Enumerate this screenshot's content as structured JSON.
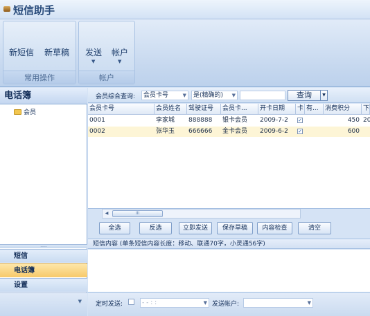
{
  "app": {
    "title": "短信助手",
    "icon": "app-logo-icon"
  },
  "ribbon": {
    "groups": [
      {
        "label": "常用操作",
        "buttons": [
          "新短信",
          "新草稿"
        ]
      },
      {
        "label": "帐户",
        "buttons": [
          "发送",
          "帐户"
        ]
      }
    ]
  },
  "sidebar": {
    "header": "电话簿",
    "tree_item": "会员",
    "nav_buttons": [
      "短信",
      "电话簿",
      "设置"
    ],
    "active": "电话簿"
  },
  "query": {
    "label": "会员综合查询:",
    "field": "会员卡号",
    "condition": "是(精确的)",
    "value": "",
    "button": "查询"
  },
  "grid": {
    "columns": [
      "会员卡号",
      "会员姓名",
      "驾驶证号",
      "会员卡...",
      "开卡日期",
      "卡...",
      "有...",
      "消费积分",
      "下"
    ],
    "rows": [
      {
        "card_no": "0001",
        "name": "李家城",
        "license": "888888",
        "card_type": "银卡会员",
        "open_date": "2009-7-2",
        "checked": true,
        "points": "450",
        "next": "20"
      },
      {
        "card_no": "0002",
        "name": "张华玉",
        "license": "666666",
        "card_type": "金卡会员",
        "open_date": "2009-6-2",
        "checked": true,
        "points": "600",
        "next": ""
      }
    ],
    "scroll_thumb": "III"
  },
  "actions": [
    "全选",
    "反选",
    "立即发送",
    "保存草稿",
    "内容检查",
    "清空"
  ],
  "sms": {
    "label": "短信内容 (单条短信内容长度：移动、联通70字，小灵通56字)",
    "content": ""
  },
  "footer": {
    "timed_label": "定时发送:",
    "datetime_placeholder": "- -   : :",
    "account_label": "发送帐户:",
    "account_value": ""
  },
  "colors": {
    "active_nav": "#f7c969",
    "selected_row": "#fdf5d6",
    "accent": "#15305a"
  }
}
